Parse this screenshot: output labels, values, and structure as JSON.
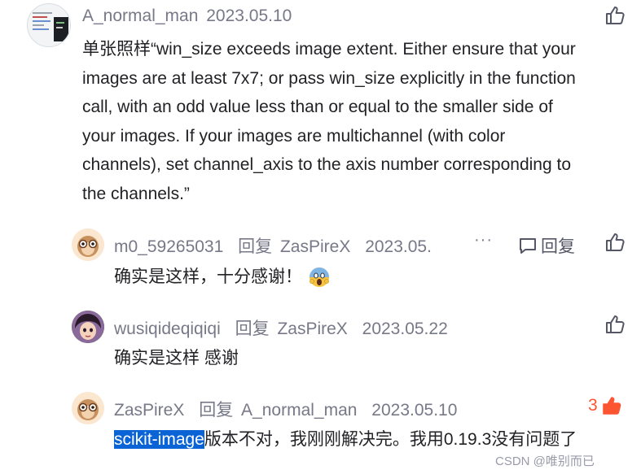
{
  "main_comment": {
    "username": "A_normal_man",
    "date": "2023.05.10",
    "text_lines": [
      "单张照样“win_size exceeds image extent. Either ensure that your",
      "images are at least 7x7; or pass win_size explicitly in the function",
      "call, with an odd value less than or equal to the smaller side of",
      "your images. If your images are multichannel (with color",
      "channels), set channel_axis to the axis number corresponding to",
      "the channels.”"
    ]
  },
  "replies": [
    {
      "username": "m0_59265031",
      "reply_label": "回复",
      "target": "ZasPireX",
      "date": "2023.05.",
      "more": "···",
      "reply_button": "回复",
      "text": "确实是这样，十分感谢！"
    },
    {
      "username": "wusiqideqiqiqi",
      "reply_label": "回复",
      "target": "ZasPireX",
      "date": "2023.05.22",
      "text": "确实是这样 感谢"
    },
    {
      "username": "ZasPireX",
      "reply_label": "回复",
      "target": "A_normal_man",
      "date": "2023.05.10",
      "like_count": "3",
      "text_selected": "scikit-image",
      "text_rest": "版本不对，我刚刚解决完。我用0.19.3没有问题了"
    }
  ],
  "watermark": "CSDN @唯别而已",
  "colors": {
    "accent_red": "#fc5531",
    "selection": "#0a64d6",
    "meta_gray": "#777888"
  }
}
